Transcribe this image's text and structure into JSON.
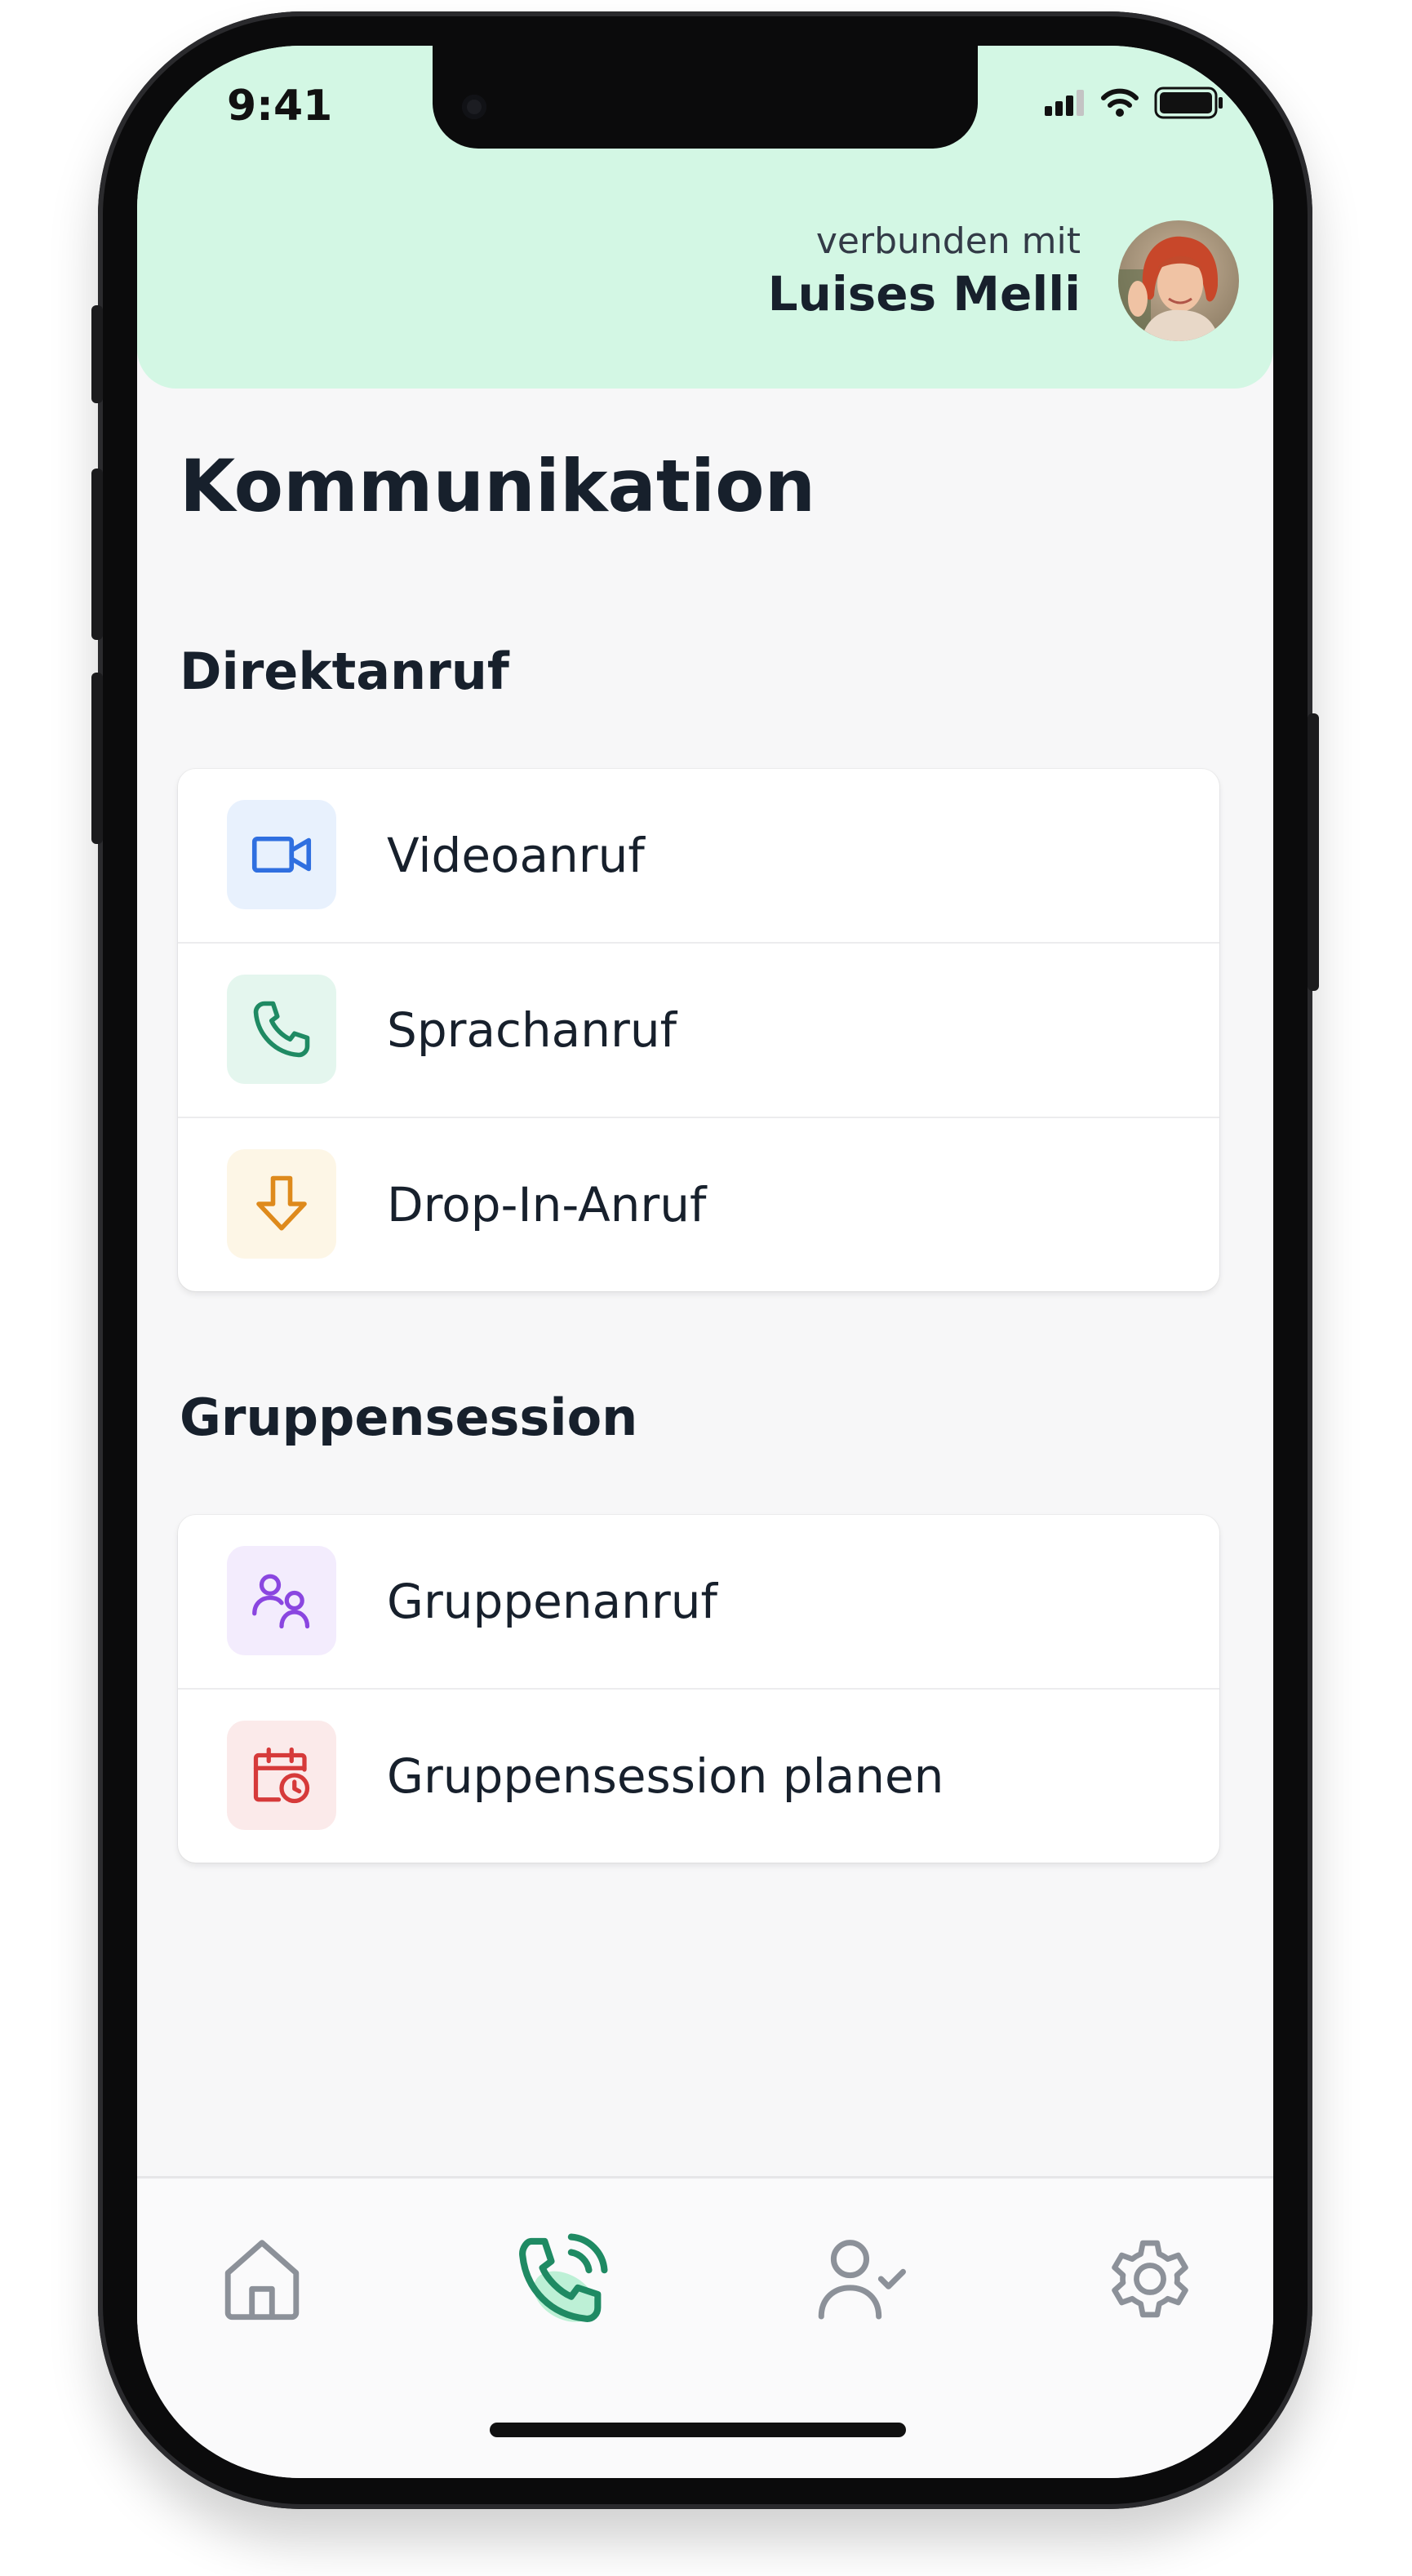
{
  "status_bar": {
    "time": "9:41"
  },
  "header": {
    "connected_label": "verbunden mit",
    "connected_name": "Luises Melli"
  },
  "page": {
    "title": "Kommunikation"
  },
  "sections": [
    {
      "title": "Direktanruf",
      "items": [
        {
          "label": "Videoanruf",
          "icon": "video-camera-icon",
          "color": "#2f6fe0",
          "bg": "#e8f1fd"
        },
        {
          "label": "Sprachanruf",
          "icon": "phone-icon",
          "color": "#1f8a63",
          "bg": "#e4f6ee"
        },
        {
          "label": "Drop-In-Anruf",
          "icon": "arrow-down-icon",
          "color": "#de8a1c",
          "bg": "#fdf6e6"
        }
      ]
    },
    {
      "title": "Gruppensession",
      "items": [
        {
          "label": "Gruppenanruf",
          "icon": "group-users-icon",
          "color": "#8a46e0",
          "bg": "#f3ecfd"
        },
        {
          "label": "Gruppensession planen",
          "icon": "calendar-clock-icon",
          "color": "#d63a3a",
          "bg": "#fbeaea"
        }
      ]
    }
  ],
  "tab_bar": {
    "tabs": [
      {
        "icon": "home-icon",
        "active": false
      },
      {
        "icon": "phone-call-icon",
        "active": true
      },
      {
        "icon": "user-check-icon",
        "active": false
      },
      {
        "icon": "settings-gear-icon",
        "active": false
      }
    ],
    "active_color": "#1f8a63",
    "inactive_color": "#8c9199"
  },
  "colors": {
    "header_bg": "#d3f7e4",
    "text_primary": "#17202c",
    "screen_bg": "#f7f7f8"
  }
}
